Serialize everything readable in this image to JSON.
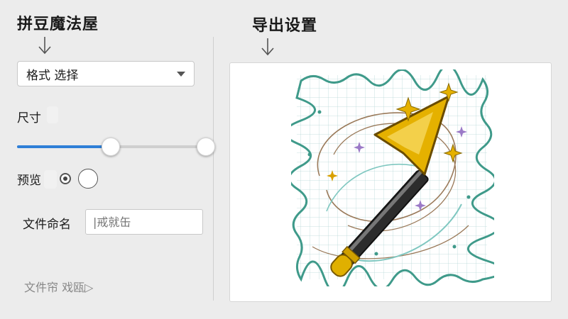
{
  "app": {
    "title": "拼豆魔法屋"
  },
  "export": {
    "title": "导出设置"
  },
  "format": {
    "selected": "格式 选择"
  },
  "size": {
    "label": "尺寸",
    "slider_percent": 49
  },
  "preview": {
    "label": "预览",
    "option_selected": 1
  },
  "filename": {
    "label": "文件命名",
    "placeholder": "|戒就缶"
  },
  "footer": {
    "link": "文件帘 戏瓯▷"
  },
  "colors": {
    "accent": "#2f7fd7",
    "background": "#ececec",
    "card": "#ffffff"
  },
  "icons": {
    "left_arrow": "arrow-down-icon",
    "right_arrow": "arrow-down-icon",
    "dropdown": "chevron-down-icon",
    "wand": "magic-wand-icon"
  }
}
